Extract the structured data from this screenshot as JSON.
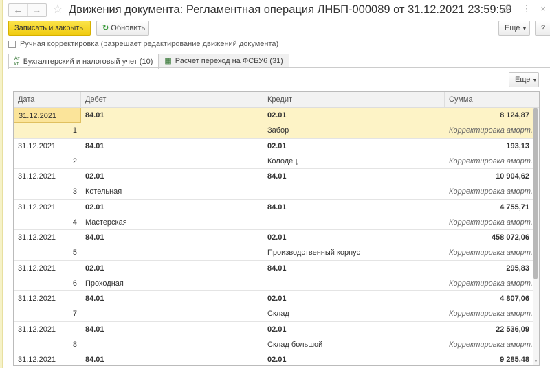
{
  "title": "Движения документа: Регламентная операция ЛНБП-000089 от 31.12.2021 23:59:59",
  "nav": {
    "back": "←",
    "forward": "→"
  },
  "toolbar": {
    "save_close": "Записать и закрыть",
    "refresh": "Обновить",
    "more": "Еще",
    "help": "?"
  },
  "manual_label": "Ручная корректировка (разрешает редактирование движений документа)",
  "tabs": [
    {
      "label": "Бухгалтерский и налоговый учет (10)"
    },
    {
      "label": "Расчет переход на ФСБУ6 (31)"
    }
  ],
  "grid_more": "Еще",
  "columns": [
    "Дата",
    "Дебет",
    "Кредит",
    "Сумма"
  ],
  "rows": [
    {
      "date": "31.12.2021",
      "n": "1",
      "debit": "84.01",
      "debit_sub": "",
      "credit": "02.01",
      "credit_sub": "Забор",
      "sum": "8 124,87",
      "content": "Корректировка аморт..."
    },
    {
      "date": "31.12.2021",
      "n": "2",
      "debit": "84.01",
      "debit_sub": "",
      "credit": "02.01",
      "credit_sub": "Колодец",
      "sum": "193,13",
      "content": "Корректировка аморт..."
    },
    {
      "date": "31.12.2021",
      "n": "3",
      "debit": "02.01",
      "debit_sub": "Котельная",
      "credit": "84.01",
      "credit_sub": "",
      "sum": "10 904,62",
      "content": "Корректировка аморт..."
    },
    {
      "date": "31.12.2021",
      "n": "4",
      "debit": "02.01",
      "debit_sub": "Мастерская",
      "credit": "84.01",
      "credit_sub": "",
      "sum": "4 755,71",
      "content": "Корректировка аморт..."
    },
    {
      "date": "31.12.2021",
      "n": "5",
      "debit": "84.01",
      "debit_sub": "",
      "credit": "02.01",
      "credit_sub": "Производственный корпус",
      "sum": "458 072,06",
      "content": "Корректировка аморт..."
    },
    {
      "date": "31.12.2021",
      "n": "6",
      "debit": "02.01",
      "debit_sub": "Проходная",
      "credit": "84.01",
      "credit_sub": "",
      "sum": "295,83",
      "content": "Корректировка аморт..."
    },
    {
      "date": "31.12.2021",
      "n": "7",
      "debit": "84.01",
      "debit_sub": "",
      "credit": "02.01",
      "credit_sub": "Склад",
      "sum": "4 807,06",
      "content": "Корректировка аморт..."
    },
    {
      "date": "31.12.2021",
      "n": "8",
      "debit": "84.01",
      "debit_sub": "",
      "credit": "02.01",
      "credit_sub": "Склад большой",
      "sum": "22 536,09",
      "content": "Корректировка аморт..."
    },
    {
      "date": "31.12.2021",
      "n": "",
      "debit": "84.01",
      "debit_sub": "",
      "credit": "02.01",
      "credit_sub": "",
      "sum": "9 285,48",
      "content": ""
    }
  ]
}
